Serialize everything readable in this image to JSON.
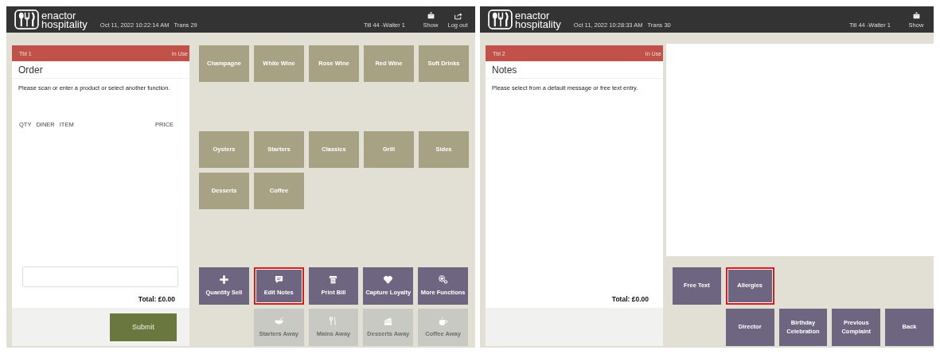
{
  "screens": [
    {
      "header": {
        "logo_top": "enactor",
        "logo_bottom": "hospitality",
        "timestamp": "Oct 11, 2022 10:22:14 AM",
        "transaction": "Trans 29",
        "till": "Till 44 -Waiter 1",
        "actions": [
          {
            "kind": "keyboard",
            "label": "Show"
          },
          {
            "kind": "logout",
            "label": "Log out"
          }
        ]
      },
      "panel": {
        "kind": "order",
        "table": "Tbl 1",
        "status": "In Use",
        "title": "Order",
        "message": "Please scan or enter a product or select another function.",
        "columns": [
          "QTY",
          "DINER",
          "ITEM",
          "PRICE"
        ],
        "total": "Total: £0.00",
        "submit": "Submit"
      },
      "main": {
        "kind": "menu",
        "category_groups": [
          [
            {
              "label": "Champagne"
            },
            {
              "label": "White Wine"
            },
            {
              "label": "Rose Wine"
            },
            {
              "label": "Red Wine"
            },
            {
              "label": "Soft Drinks"
            }
          ],
          [
            {
              "label": "Oysters"
            },
            {
              "label": "Starters"
            },
            {
              "label": "Classics"
            },
            {
              "label": "Grill"
            },
            {
              "label": "Sides"
            },
            {
              "label": "Desserts"
            },
            {
              "label": "Coffee"
            }
          ]
        ]
      },
      "function_rows": [
        [
          {
            "kind": "plus",
            "label": "Quantity Sell",
            "disabled": false,
            "highlighted": false
          },
          {
            "kind": "speech",
            "label": "Edit Notes",
            "disabled": false,
            "highlighted": true
          },
          {
            "kind": "printer",
            "label": "Print Bill",
            "disabled": false,
            "highlighted": false
          },
          {
            "kind": "heart",
            "label": "Capture Loyalty",
            "disabled": false,
            "highlighted": false
          },
          {
            "kind": "gears",
            "label": "More Functions",
            "disabled": false,
            "highlighted": false
          }
        ],
        [
          {
            "kind": "bowl",
            "label": "Starters Away",
            "disabled": true,
            "highlighted": false
          },
          {
            "kind": "cutlery",
            "label": "Mains Away",
            "disabled": true,
            "highlighted": false
          },
          {
            "kind": "cake",
            "label": "Desserts Away",
            "disabled": true,
            "highlighted": false
          },
          {
            "kind": "cup",
            "label": "Coffee Away",
            "disabled": true,
            "highlighted": false
          }
        ]
      ]
    },
    {
      "header": {
        "logo_top": "enactor",
        "logo_bottom": "hospitality",
        "timestamp": "Oct 11, 2022 10:28:33 AM",
        "transaction": "Trans 30",
        "till": "Till 44 -Waiter 1",
        "actions": [
          {
            "kind": "keyboard",
            "label": "Show"
          }
        ]
      },
      "panel": {
        "kind": "notes",
        "table": "Tbl 2",
        "status": "In Use",
        "title": "Notes",
        "message": "Please select from a default message or free text entry.",
        "total": "Total: £0.00"
      },
      "main": {
        "kind": "notes_area"
      },
      "function_rows": [
        [
          {
            "kind": "text",
            "label": "Free Text",
            "disabled": false,
            "highlighted": false
          },
          {
            "kind": "text",
            "label": "Allergies",
            "disabled": false,
            "highlighted": true
          }
        ],
        [
          {
            "kind": "text",
            "label": "Director",
            "disabled": false,
            "highlighted": false
          },
          {
            "kind": "text",
            "label": "Birthday Celebration",
            "disabled": false,
            "highlighted": false
          },
          {
            "kind": "text",
            "label": "Previous Complaint",
            "disabled": false,
            "highlighted": false
          },
          {
            "kind": "text",
            "label": "Back",
            "disabled": false,
            "highlighted": false
          }
        ]
      ]
    }
  ]
}
